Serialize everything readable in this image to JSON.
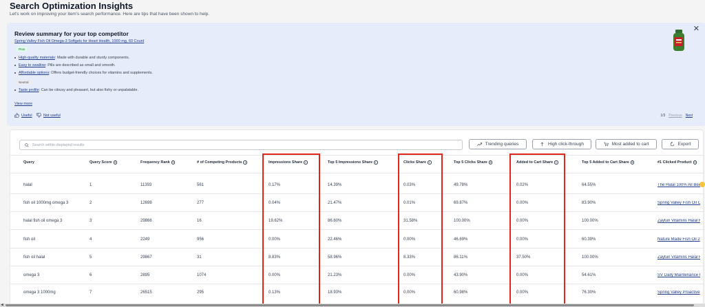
{
  "header": {
    "title": "Search Optimization Insights",
    "subtitle": "Let's work on improving your item's search performance. Here are tips that have been shown to help."
  },
  "competitor": {
    "title": "Review summary for your top competitor",
    "product": "Spring Valley Fish Oil Omega-3 Softgels for Heart Health, 1000 mg, 60 Count",
    "pros_tag": "Pros",
    "pros": [
      {
        "label": "High-quality materials",
        "text": ": Made with durable and sturdy components."
      },
      {
        "label": "Easy to swallow",
        "text": ": Pills are described as small and smooth."
      },
      {
        "label": "Affordable options",
        "text": ": Offers budget-friendly choices for vitamins and supplements."
      }
    ],
    "neutral_tag": "Neutral",
    "neutral": [
      {
        "label": "Taste profile",
        "text": ": Can be citrusy and pleasant, but also fishy or unpalatable."
      }
    ],
    "view_more": "View more",
    "useful": "Useful",
    "not_useful": "Not useful",
    "pager": {
      "count": "1/3",
      "previous": "Previous",
      "next": "Next"
    },
    "close": "✕"
  },
  "toolbar": {
    "search_placeholder": "Search within displayed results",
    "trending": "Trending queries",
    "high_click": "High click-through",
    "most_added": "Most added to cart",
    "export": "Export"
  },
  "table": {
    "columns": [
      "Query",
      "Query Score",
      "Frequency Rank",
      "# of Competing Products",
      "Impressions Share",
      "Top 5 Impressions Share",
      "Clicks Share",
      "Top 5 Clicks Share",
      "Added to Cart Share",
      "Top 5 Added to Cart Share",
      "#1 Clicked Product"
    ],
    "rows": [
      [
        "halal",
        "1",
        "11393",
        "561",
        "0.17%",
        "14.39%",
        "0.03%",
        "49.78%",
        "0.02%",
        "64.55%",
        "The Halal 100% All Bee"
      ],
      [
        "fish oil 1000mg omega 3",
        "2",
        "12698",
        "277",
        "0.04%",
        "21.47%",
        "0.01%",
        "69.87%",
        "0.00%",
        "83.90%",
        "Spring Valley Fish Oil O"
      ],
      [
        "halal fish oil omega 3",
        "3",
        "29866",
        "16",
        "19.62%",
        "86.60%",
        "31.58%",
        "100.00%",
        "0.00%",
        "100.00%",
        "Zaytun Vitamins Halal F"
      ],
      [
        "fish oil",
        "4",
        "2249",
        "956",
        "0.00%",
        "22.46%",
        "0.00%",
        "46.69%",
        "0.00%",
        "60.39%",
        "Nature Made Fish Oil 2"
      ],
      [
        "fish oil halal",
        "5",
        "29867",
        "31",
        "8.83%",
        "58.96%",
        "8.33%",
        "86.11%",
        "37.50%",
        "100.00%",
        "Zaytun Vitamins Halal F"
      ],
      [
        "omega 3",
        "6",
        "2895",
        "1074",
        "0.00%",
        "21.23%",
        "0.00%",
        "43.90%",
        "0.00%",
        "54.61%",
        "SV Daily Maintenance C"
      ],
      [
        "omega 3 1000mg",
        "7",
        "26515",
        "295",
        "0.13%",
        "18.93%",
        "0.00%",
        "60.98%",
        "0.00%",
        "76.30%",
        "Spring Valley Proactive"
      ]
    ]
  },
  "colors": {
    "highlight": "#e0261b",
    "card_bg": "#e6ecfa",
    "link": "#1e3a8a"
  }
}
